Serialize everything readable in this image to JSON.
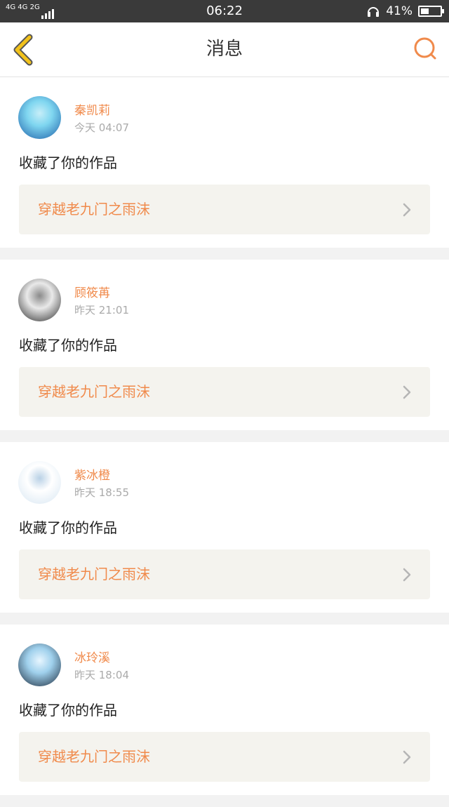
{
  "status_bar": {
    "network": "4G 4G 2G",
    "time": "06:22",
    "battery": "41%",
    "battery_level": 0.41
  },
  "navbar": {
    "title": "消息"
  },
  "messages": [
    {
      "username": "秦凯莉",
      "time": "今天 04:07",
      "action": "收藏了你的作品",
      "work_title": "穿越老九门之雨沫",
      "avatar_colors": [
        "#1d5fa8",
        "#7fd6f0",
        "#c7eef8"
      ]
    },
    {
      "username": "顾筱苒",
      "time": "昨天 21:01",
      "action": "收藏了你的作品",
      "work_title": "穿越老九门之雨沫",
      "avatar_colors": [
        "#2b2b2b",
        "#e9e9e9",
        "#8a8a8a"
      ]
    },
    {
      "username": "紫冰橙",
      "time": "昨天 18:55",
      "action": "收藏了你的作品",
      "work_title": "穿越老九门之雨沫",
      "avatar_colors": [
        "#d7e6f2",
        "#ffffff",
        "#b9d1e6"
      ]
    },
    {
      "username": "冰玲溪",
      "time": "昨天 18:04",
      "action": "收藏了你的作品",
      "work_title": "穿越老九门之雨沫",
      "avatar_colors": [
        "#1b2a3c",
        "#9fd0ec",
        "#e8f6ff"
      ]
    }
  ],
  "colors": {
    "accent": "#f08a4b",
    "back_icon": "#f2c21b",
    "work_box_bg": "#f4f3ee"
  },
  "icons": {
    "back": "chevron-left-icon",
    "search": "search-icon",
    "work_arrow": "chevron-right-icon"
  }
}
